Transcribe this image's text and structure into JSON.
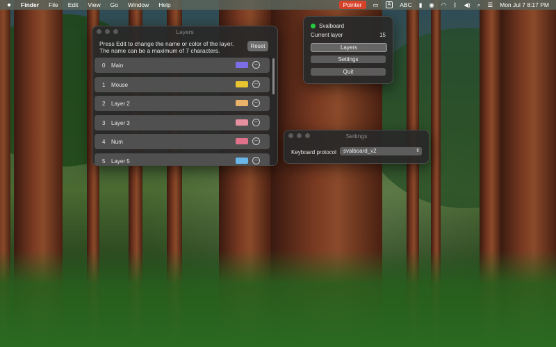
{
  "menubar": {
    "apple_icon": "apple-icon",
    "app_name": "Finder",
    "menus": [
      "File",
      "Edit",
      "View",
      "Go",
      "Window",
      "Help"
    ],
    "pointer_label": "Pointer",
    "input_source": "ABC",
    "clock": "Mon Jul 7  8:17 PM"
  },
  "layers_window": {
    "title": "Layers",
    "instruction_line1": "Press Edit to change the name or color of the layer.",
    "instruction_line2": "The name can be a maximum of 7 characters.",
    "reset_label": "Reset",
    "layers": [
      {
        "index": "0",
        "name": "Main",
        "color": "#7b6ee8"
      },
      {
        "index": "1",
        "name": "Mouse",
        "color": "#e8c531"
      },
      {
        "index": "2",
        "name": "Layer 2",
        "color": "#e9b36a"
      },
      {
        "index": "3",
        "name": "Layer 3",
        "color": "#e690a0"
      },
      {
        "index": "4",
        "name": "Num",
        "color": "#e0728c"
      },
      {
        "index": "5",
        "name": "Layer 5",
        "color": "#6ab6e9"
      }
    ]
  },
  "popover": {
    "device_name": "Svalboard",
    "status_color": "#27c93f",
    "current_layer_label": "Current layer",
    "current_layer_value": "15",
    "buttons": [
      "Layers",
      "Settings",
      "Quit"
    ]
  },
  "settings_window": {
    "title": "Settings",
    "protocol_label": "Keyboard protocol",
    "protocol_value": "svalboard_v2"
  }
}
